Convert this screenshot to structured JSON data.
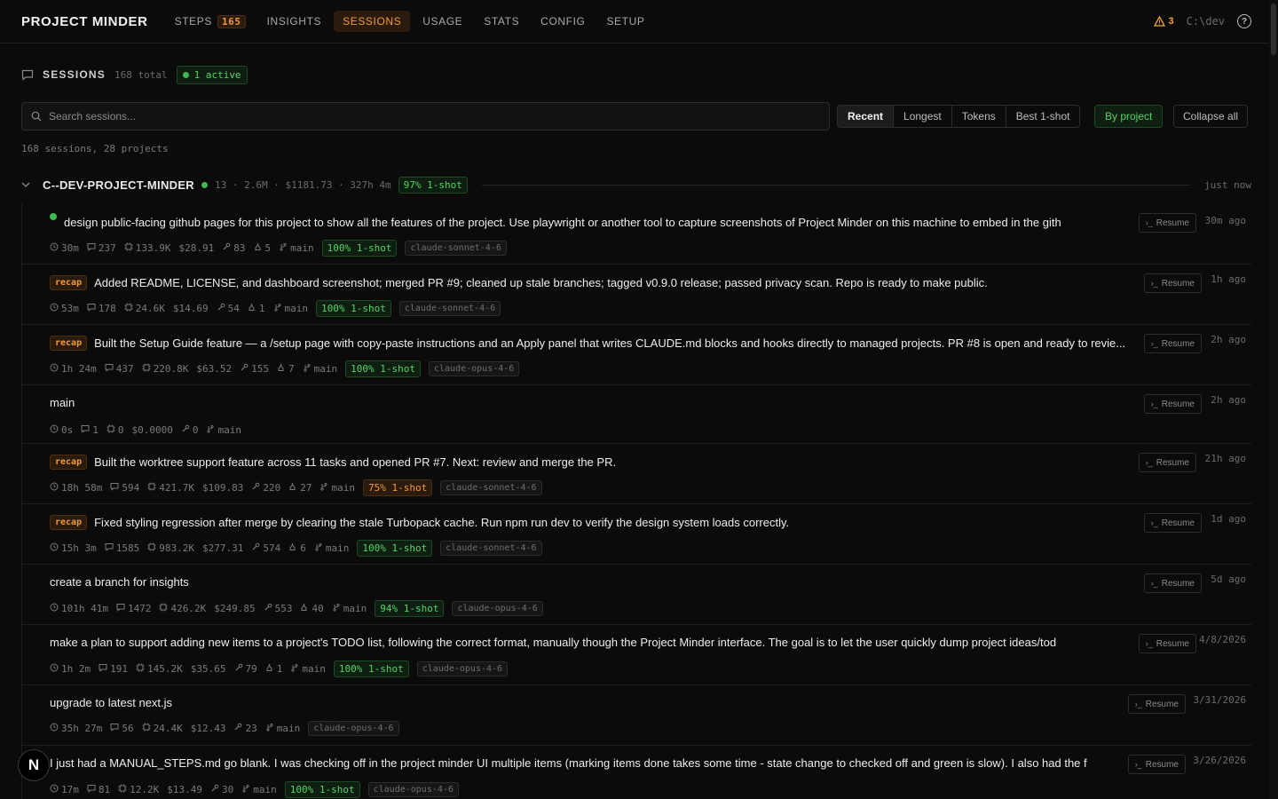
{
  "app": {
    "brand": "PROJECT MINDER"
  },
  "nav": [
    {
      "label": "STEPS",
      "badge": "165"
    },
    {
      "label": "INSIGHTS"
    },
    {
      "label": "SESSIONS",
      "active": true
    },
    {
      "label": "USAGE"
    },
    {
      "label": "STATS"
    },
    {
      "label": "CONFIG"
    },
    {
      "label": "SETUP"
    }
  ],
  "topright": {
    "warnings": "3",
    "path": "C:\\dev",
    "help": "?"
  },
  "header": {
    "title": "SESSIONS",
    "total": "168 total",
    "active": "1 active"
  },
  "search": {
    "placeholder": "Search sessions..."
  },
  "sort": [
    "Recent",
    "Longest",
    "Tokens",
    "Best 1-shot"
  ],
  "actions": {
    "by_project": "By project",
    "collapse_all": "Collapse all"
  },
  "summary": "168 sessions, 28 projects",
  "group": {
    "name": "C--DEV-PROJECT-MINDER",
    "stats": "13 · 2.6M · $1181.73 · 327h 4m",
    "oneshot": "97% 1-shot",
    "time": "just now"
  },
  "resume_label": "Resume",
  "sessions": [
    {
      "active": true,
      "recap": false,
      "title": "design public-facing github pages for this project to show all the features of the project. Use playwright or another tool to capture screenshots of Project Minder on this machine to embed in the gith",
      "time": "30m ago",
      "duration": "30m",
      "msgs": "237",
      "tokens": "133.9K",
      "cost": "$28.91",
      "tools": "83",
      "agents": "5",
      "branch": "main",
      "oneshot": "100% 1-shot",
      "oneshot_color": "green",
      "model": "claude-sonnet-4-6"
    },
    {
      "recap": true,
      "title": "Added README, LICENSE, and dashboard screenshot; merged PR #9; cleaned up stale branches; tagged v0.9.0 release; passed privacy scan. Repo is ready to make public.",
      "time": "1h ago",
      "duration": "53m",
      "msgs": "178",
      "tokens": "24.6K",
      "cost": "$14.69",
      "tools": "54",
      "agents": "1",
      "branch": "main",
      "oneshot": "100% 1-shot",
      "oneshot_color": "green",
      "model": "claude-sonnet-4-6"
    },
    {
      "recap": true,
      "title": "Built the Setup Guide feature — a /setup page with copy-paste instructions and an Apply panel that writes CLAUDE.md blocks and hooks directly to managed projects. PR #8 is open and ready to revie...",
      "time": "2h ago",
      "duration": "1h 24m",
      "msgs": "437",
      "tokens": "220.8K",
      "cost": "$63.52",
      "tools": "155",
      "agents": "7",
      "branch": "main",
      "oneshot": "100% 1-shot",
      "oneshot_color": "green",
      "model": "claude-opus-4-6"
    },
    {
      "recap": false,
      "title": "main",
      "time": "2h ago",
      "duration": "0s",
      "msgs": "1",
      "tokens": "0",
      "cost": "$0.0000",
      "tools": "0",
      "agents": "",
      "branch": "main",
      "oneshot": "",
      "oneshot_color": "",
      "model": ""
    },
    {
      "recap": true,
      "title": "Built the worktree support feature across 11 tasks and opened PR #7. Next: review and merge the PR.",
      "time": "21h ago",
      "duration": "18h 58m",
      "msgs": "594",
      "tokens": "421.7K",
      "cost": "$109.83",
      "tools": "220",
      "agents": "27",
      "branch": "main",
      "oneshot": "75% 1-shot",
      "oneshot_color": "orange",
      "model": "claude-sonnet-4-6"
    },
    {
      "recap": true,
      "title": "Fixed styling regression after merge by clearing the stale Turbopack cache. Run npm run dev to verify the design system loads correctly.",
      "time": "1d ago",
      "duration": "15h 3m",
      "msgs": "1585",
      "tokens": "983.2K",
      "cost": "$277.31",
      "tools": "574",
      "agents": "6",
      "branch": "main",
      "oneshot": "100% 1-shot",
      "oneshot_color": "green",
      "model": "claude-sonnet-4-6"
    },
    {
      "recap": false,
      "title": "create a branch for insights",
      "time": "5d ago",
      "duration": "101h 41m",
      "msgs": "1472",
      "tokens": "426.2K",
      "cost": "$249.85",
      "tools": "553",
      "agents": "40",
      "branch": "main",
      "oneshot": "94% 1-shot",
      "oneshot_color": "green",
      "model": "claude-opus-4-6"
    },
    {
      "recap": false,
      "title": "make a plan to support adding new items to a project's TODO list, following the correct format, manually though the Project Minder interface. The goal is to let the user quickly dump project ideas/tod",
      "time": "4/8/2026",
      "duration": "1h 2m",
      "msgs": "191",
      "tokens": "145.2K",
      "cost": "$35.65",
      "tools": "79",
      "agents": "1",
      "branch": "main",
      "oneshot": "100% 1-shot",
      "oneshot_color": "green",
      "model": "claude-opus-4-6"
    },
    {
      "recap": false,
      "title": "upgrade to latest next.js",
      "time": "3/31/2026",
      "duration": "35h 27m",
      "msgs": "56",
      "tokens": "24.4K",
      "cost": "$12.43",
      "tools": "23",
      "agents": "",
      "branch": "main",
      "oneshot": "",
      "oneshot_color": "",
      "model": "claude-opus-4-6"
    },
    {
      "recap": false,
      "title": "I just had a MANUAL_STEPS.md go blank. I was checking off in the project minder UI multiple items (marking items done takes some time - state change to checked off and green is slow). I also had the f",
      "time": "3/26/2026",
      "duration": "17m",
      "msgs": "81",
      "tokens": "12.2K",
      "cost": "$13.49",
      "tools": "30",
      "agents": "",
      "branch": "main",
      "oneshot": "100% 1-shot",
      "oneshot_color": "green",
      "model": "claude-opus-4-6"
    }
  ],
  "floating_badge": "N",
  "colors": {
    "accent": "#f29a3c",
    "success": "#3fb950",
    "bg": "#0b0b0b"
  }
}
